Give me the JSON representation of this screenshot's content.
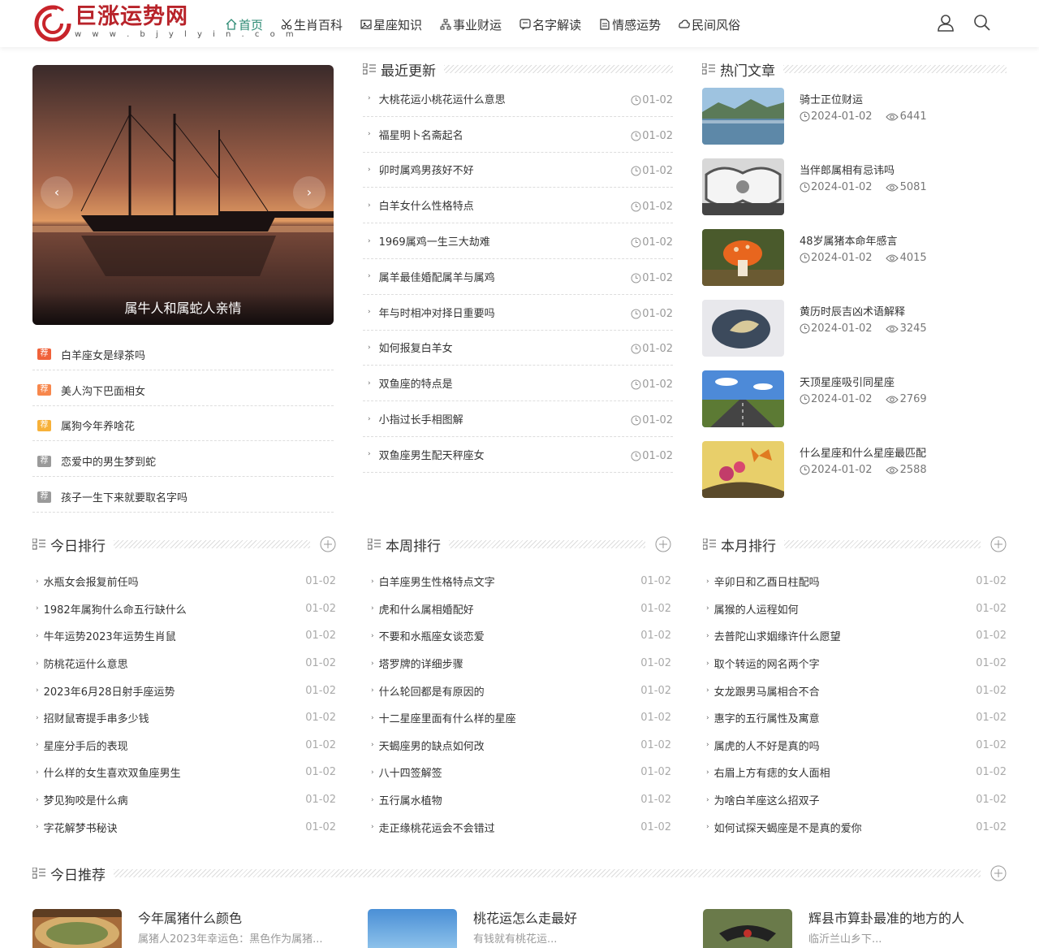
{
  "site": {
    "name": "巨涨运势网",
    "url": "w w w . b j y l y i n . c o m"
  },
  "nav": [
    {
      "label": "首页",
      "active": true,
      "icon": "home-icon"
    },
    {
      "label": "生肖百科",
      "icon": "scissors-icon"
    },
    {
      "label": "星座知识",
      "icon": "image-icon"
    },
    {
      "label": "事业财运",
      "icon": "sitemap-icon"
    },
    {
      "label": "名字解读",
      "icon": "chat-icon"
    },
    {
      "label": "情感运势",
      "icon": "doc-icon"
    },
    {
      "label": "民间风俗",
      "icon": "cloud-icon"
    }
  ],
  "header_icons": [
    "user-icon",
    "search-icon"
  ],
  "slider": {
    "caption": "属牛人和属蛇人亲情",
    "prev": "‹",
    "next": "›"
  },
  "recommend": {
    "badge": "荐",
    "items": [
      {
        "text": "白羊座女是绿茶吗",
        "color": "#f0623a"
      },
      {
        "text": "美人沟下巴面相女",
        "color": "#f7874c"
      },
      {
        "text": "属狗今年养啥花",
        "color": "#f7b139"
      },
      {
        "text": "恋爱中的男生梦到蛇",
        "color": "#9a9a9a"
      },
      {
        "text": "孩子一生下来就要取名字吗",
        "color": "#9a9a9a"
      }
    ]
  },
  "latest": {
    "title": "最近更新",
    "items": [
      {
        "text": "大桃花运小桃花运什么意思",
        "date": "01-02"
      },
      {
        "text": "福星明卜名斋起名",
        "date": "01-02"
      },
      {
        "text": "卯时属鸡男孩好不好",
        "date": "01-02"
      },
      {
        "text": "白羊女什么性格特点",
        "date": "01-02"
      },
      {
        "text": "1969属鸡一生三大劫难",
        "date": "01-02"
      },
      {
        "text": "属羊最佳婚配属羊与属鸡",
        "date": "01-02"
      },
      {
        "text": "年与时相冲对择日重要吗",
        "date": "01-02"
      },
      {
        "text": "如何报复白羊女",
        "date": "01-02"
      },
      {
        "text": "双鱼座的特点是",
        "date": "01-02"
      },
      {
        "text": "小指过长手相图解",
        "date": "01-02"
      },
      {
        "text": "双鱼座男生配天秤座女",
        "date": "01-02"
      }
    ]
  },
  "hot": {
    "title": "热门文章",
    "items": [
      {
        "title": "骑士正位财运",
        "date": "2024-01-02",
        "views": "6441",
        "thumb": "lake"
      },
      {
        "title": "当伴郎属相有忌讳吗",
        "date": "2024-01-02",
        "views": "5081",
        "thumb": "ornament"
      },
      {
        "title": "48岁属猪本命年感言",
        "date": "2024-01-02",
        "views": "4015",
        "thumb": "mushroom"
      },
      {
        "title": "黄历时辰吉凶术语解释",
        "date": "2024-01-02",
        "views": "3245",
        "thumb": "stone"
      },
      {
        "title": "天顶星座吸引同星座",
        "date": "2024-01-02",
        "views": "2769",
        "thumb": "road"
      },
      {
        "title": "什么星座和什么星座最匹配",
        "date": "2024-01-02",
        "views": "2588",
        "thumb": "butterfly"
      }
    ]
  },
  "rank_today": {
    "title": "今日排行",
    "items": [
      {
        "text": "水瓶女会报复前任吗",
        "date": "01-02"
      },
      {
        "text": "1982年属狗什么命五行缺什么",
        "date": "01-02"
      },
      {
        "text": "牛年运势2023年运势生肖鼠",
        "date": "01-02"
      },
      {
        "text": "防桃花运什么意思",
        "date": "01-02"
      },
      {
        "text": "2023年6月28日射手座运势",
        "date": "01-02"
      },
      {
        "text": "招财鼠寄提手串多少钱",
        "date": "01-02"
      },
      {
        "text": "星座分手后的表现",
        "date": "01-02"
      },
      {
        "text": "什么样的女生喜欢双鱼座男生",
        "date": "01-02"
      },
      {
        "text": "梦见狗咬是什么病",
        "date": "01-02"
      },
      {
        "text": "字花解梦书秘诀",
        "date": "01-02"
      }
    ]
  },
  "rank_week": {
    "title": "本周排行",
    "items": [
      {
        "text": "白羊座男生性格特点文字",
        "date": "01-02"
      },
      {
        "text": "虎和什么属相婚配好",
        "date": "01-02"
      },
      {
        "text": "不要和水瓶座女谈恋爱",
        "date": "01-02"
      },
      {
        "text": "塔罗牌的详细步骤",
        "date": "01-02"
      },
      {
        "text": "什么轮回都是有原因的",
        "date": "01-02"
      },
      {
        "text": "十二星座里面有什么样的星座",
        "date": "01-02"
      },
      {
        "text": "天蝎座男的缺点如何改",
        "date": "01-02"
      },
      {
        "text": "八十四签解签",
        "date": "01-02"
      },
      {
        "text": "五行属水植物",
        "date": "01-02"
      },
      {
        "text": "走正缘桃花运会不会错过",
        "date": "01-02"
      }
    ]
  },
  "rank_month": {
    "title": "本月排行",
    "items": [
      {
        "text": "辛卯日和乙酉日柱配吗",
        "date": "01-02"
      },
      {
        "text": "属猴的人运程如何",
        "date": "01-02"
      },
      {
        "text": "去普陀山求姻缘许什么愿望",
        "date": "01-02"
      },
      {
        "text": "取个转运的网名两个字",
        "date": "01-02"
      },
      {
        "text": "女龙跟男马属相合不合",
        "date": "01-02"
      },
      {
        "text": "惠字的五行属性及寓意",
        "date": "01-02"
      },
      {
        "text": "属虎的人不好是真的吗",
        "date": "01-02"
      },
      {
        "text": "右眉上方有痣的女人面相",
        "date": "01-02"
      },
      {
        "text": "为啥白羊座这么招双子",
        "date": "01-02"
      },
      {
        "text": "如何试探天蝎座是不是真的爱你",
        "date": "01-02"
      }
    ]
  },
  "today_rec": {
    "title": "今日推荐",
    "items": [
      {
        "title": "今年属猪什么颜色",
        "desc": "属猪人2023年幸运色：黑色作为属猪...",
        "thumb": "food"
      },
      {
        "title": "桃花运怎么走最好",
        "desc": "有钱就有桃花运...",
        "thumb": "sky"
      },
      {
        "title": "辉县市算卦最准的地方的人",
        "desc": "临沂兰山乡下...",
        "thumb": "bird"
      }
    ]
  },
  "colors": {
    "accent": "#2c8a73",
    "brand": "#b8232a"
  }
}
